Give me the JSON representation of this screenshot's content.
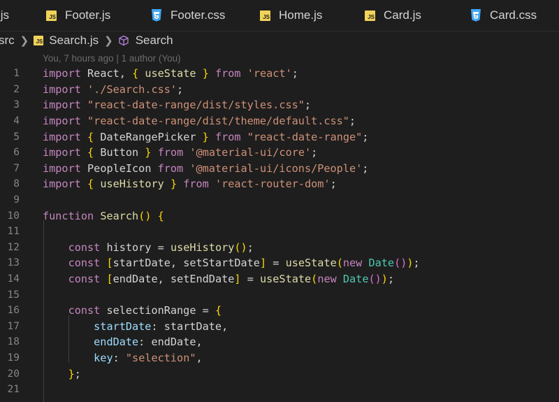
{
  "tabs": [
    {
      "label": ".js",
      "icon": "none"
    },
    {
      "label": "Footer.js",
      "icon": "js-icon"
    },
    {
      "label": "Footer.css",
      "icon": "css-icon"
    },
    {
      "label": "Home.js",
      "icon": "js-icon"
    },
    {
      "label": "Card.js",
      "icon": "js-icon"
    },
    {
      "label": "Card.css",
      "icon": "css-icon"
    }
  ],
  "breadcrumb": {
    "root": "src",
    "file": "Search.js",
    "symbol": "Search"
  },
  "blame": "You, 7 hours ago | 1 author (You)",
  "lines": [
    {
      "n": "1",
      "text": "import React, { useState } from 'react';"
    },
    {
      "n": "2",
      "text": "import './Search.css';"
    },
    {
      "n": "3",
      "text": "import \"react-date-range/dist/styles.css\";"
    },
    {
      "n": "4",
      "text": "import \"react-date-range/dist/theme/default.css\";"
    },
    {
      "n": "5",
      "text": "import { DateRangePicker } from \"react-date-range\";"
    },
    {
      "n": "6",
      "text": "import { Button } from '@material-ui/core';"
    },
    {
      "n": "7",
      "text": "import PeopleIcon from '@material-ui/icons/People';"
    },
    {
      "n": "8",
      "text": "import { useHistory } from 'react-router-dom';"
    },
    {
      "n": "9",
      "text": ""
    },
    {
      "n": "10",
      "text": "function Search() {"
    },
    {
      "n": "11",
      "text": ""
    },
    {
      "n": "12",
      "text": "    const history = useHistory();"
    },
    {
      "n": "13",
      "text": "    const [startDate, setStartDate] = useState(new Date());"
    },
    {
      "n": "14",
      "text": "    const [endDate, setEndDate] = useState(new Date());"
    },
    {
      "n": "15",
      "text": ""
    },
    {
      "n": "16",
      "text": "    const selectionRange = {"
    },
    {
      "n": "17",
      "text": "        startDate: startDate,"
    },
    {
      "n": "18",
      "text": "        endDate: endDate,"
    },
    {
      "n": "19",
      "text": "        key: \"selection\","
    },
    {
      "n": "20",
      "text": "    };"
    },
    {
      "n": "21",
      "text": ""
    }
  ],
  "colors": {
    "background": "#1e1e1e",
    "keyword": "#c586c0",
    "string": "#ce9178",
    "variable": "#9cdcfe",
    "class": "#4ec9b0",
    "function": "#dcdcaa",
    "js_icon": "#f1d35a",
    "css_icon": "#42a5f5"
  }
}
